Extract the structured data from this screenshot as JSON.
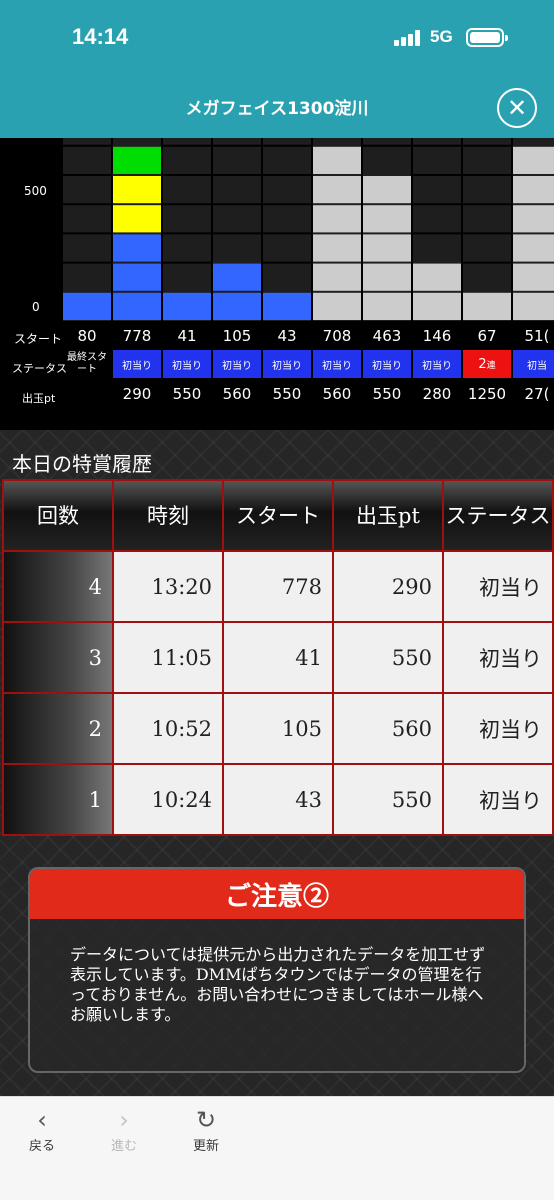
{
  "status_bar": {
    "time": "14:14",
    "network": "5G"
  },
  "header": {
    "title": "メガフェイス1300淀川",
    "close_icon": "close-icon"
  },
  "chart_data": {
    "type": "bar",
    "y_ticks": [
      "500",
      "0"
    ],
    "ylim": [
      0,
      600
    ],
    "columns": [
      {
        "start": "80",
        "status": "最終スタート",
        "pt": "",
        "value": 100,
        "color": "#3366ff",
        "kind": "last"
      },
      {
        "start": "778",
        "status": "初当り",
        "pt": "290",
        "value": 600,
        "colors": [
          "#3366ff",
          "#3366ff",
          "#3366ff",
          "#ffff00",
          "#ffff00",
          "#00dd00"
        ]
      },
      {
        "start": "41",
        "status": "初当り",
        "pt": "550",
        "value": 100,
        "color": "#3366ff"
      },
      {
        "start": "105",
        "status": "初当り",
        "pt": "560",
        "value": 200,
        "color": "#3366ff"
      },
      {
        "start": "43",
        "status": "初当り",
        "pt": "550",
        "value": 100,
        "color": "#3366ff"
      },
      {
        "start": "708",
        "status": "初当り",
        "pt": "560",
        "value": 600,
        "color": "#cccccc"
      },
      {
        "start": "463",
        "status": "初当り",
        "pt": "550",
        "value": 500,
        "color": "#cccccc"
      },
      {
        "start": "146",
        "status": "初当り",
        "pt": "280",
        "value": 200,
        "color": "#cccccc"
      },
      {
        "start": "67",
        "status": "2連",
        "pt": "1250",
        "value": 100,
        "color": "#cccccc",
        "kind": "red"
      },
      {
        "start": "51(",
        "status": "初当",
        "pt": "27(",
        "value": 600,
        "color": "#cccccc"
      }
    ]
  },
  "labels": {
    "start": "スタート",
    "status": "ステータス",
    "pt": "出玉pt"
  },
  "history": {
    "title": "本日の特賞履歴",
    "headers": [
      "回数",
      "時刻",
      "スタート",
      "出玉pt",
      "ステータス"
    ],
    "rows": [
      [
        "4",
        "13:20",
        "778",
        "290",
        "初当り"
      ],
      [
        "3",
        "11:05",
        "41",
        "550",
        "初当り"
      ],
      [
        "2",
        "10:52",
        "105",
        "560",
        "初当り"
      ],
      [
        "1",
        "10:24",
        "43",
        "550",
        "初当り"
      ]
    ]
  },
  "notice": {
    "title": "ご注意②",
    "body": "データについては提供元から出力されたデータを加工せず表示しています。DMMぱちタウンではデータの管理を行っておりません。お問い合わせにつきましてはホール様へお願いします。"
  },
  "toolbar": {
    "back": "戻る",
    "forward": "進む",
    "reload": "更新"
  }
}
